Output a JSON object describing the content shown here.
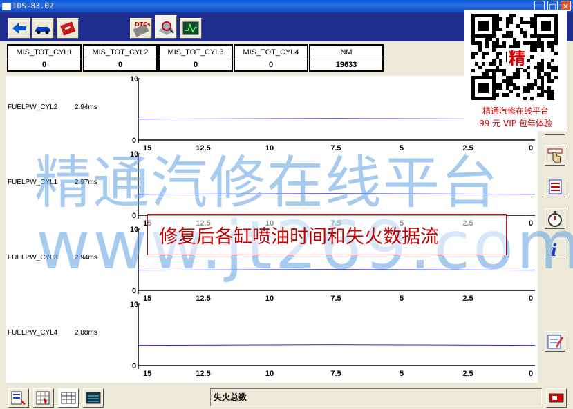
{
  "window": {
    "title": "IDS-83.02",
    "controls": [
      "_",
      "□",
      "✕"
    ]
  },
  "toolbar": {
    "buttons": [
      {
        "icon": "back-arrow-icon"
      },
      {
        "icon": "car-icon"
      },
      {
        "icon": "toolbox-icon"
      },
      {
        "icon": "dtc-icon",
        "label": "DTCs"
      },
      {
        "icon": "datalogger-icon"
      },
      {
        "icon": "oscilloscope-icon"
      }
    ]
  },
  "header_table": {
    "columns": [
      {
        "label": "MIS_TOT_CYL1",
        "value": "0"
      },
      {
        "label": "MIS_TOT_CYL2",
        "value": "0"
      },
      {
        "label": "MIS_TOT_CYL3",
        "value": "0"
      },
      {
        "label": "MIS_TOT_CYL4",
        "value": "0"
      },
      {
        "label": "NM",
        "value": "19633"
      }
    ]
  },
  "graphs": [
    {
      "name": "FUELPW_CYL2",
      "value": "2.94ms",
      "ymax": "10",
      "ymin": "0",
      "level": 0.34
    },
    {
      "name": "FUELPW_CYL1",
      "value": "2.97ms",
      "ymax": "10",
      "ymin": "0",
      "level": 0.34
    },
    {
      "name": "FUELPW_CYL3",
      "value": "2.94ms",
      "ymax": "10",
      "ymin": "0",
      "level": 0.33
    },
    {
      "name": "FUELPW_CYL4",
      "value": "2.88ms",
      "ymax": "10",
      "ymin": "0",
      "level": 0.33
    }
  ],
  "x_ticks": [
    "15",
    "12.5",
    "10",
    "7.5",
    "5",
    "2.5",
    "0"
  ],
  "status": {
    "text": "失火总数"
  },
  "watermark": {
    "line1": "精通汽修在线平台",
    "line2": "www.jt269.com"
  },
  "annotation": {
    "text": "修复后各缸喷油时间和失火数据流"
  },
  "promo": {
    "badge": "精",
    "line1": "精通汽修在线平台",
    "line2": "99 元 VIP 包年体验"
  },
  "colors": {
    "trace": "#2a2adc",
    "toolbar_bg": "#1f2d8f",
    "watermark": "#5fa0e1",
    "annotation": "#c00000"
  }
}
